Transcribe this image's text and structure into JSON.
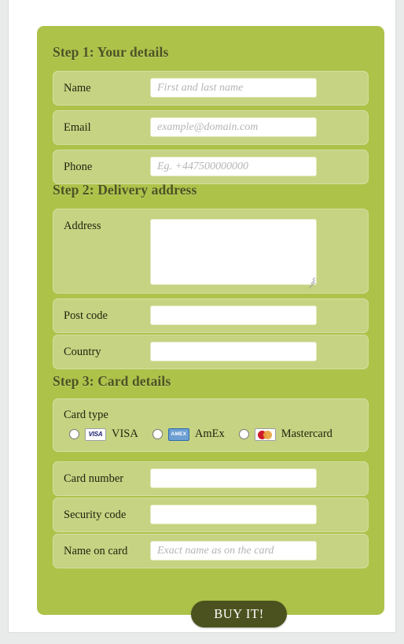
{
  "theme": {
    "page_background": "#e9eaea",
    "container_background": "#ffffff",
    "panel_green": "#adc249",
    "row_green": "#c6d382",
    "row_border": "#d4dfa1",
    "heading_color": "#4d5324",
    "label_color": "#22240f",
    "button_background": "#4b521f",
    "button_text_color": "#ffffff",
    "placeholder_color": "#b4b4b4",
    "input_background": "#ffffff"
  },
  "steps": [
    {
      "heading": "Step 1: Your details",
      "fields": [
        {
          "label": "Name",
          "value": "",
          "placeholder": "First and last name"
        },
        {
          "label": "Email",
          "value": "",
          "placeholder": "example@domain.com"
        },
        {
          "label": "Phone",
          "value": "",
          "placeholder": "Eg. +447500000000"
        }
      ]
    },
    {
      "heading": "Step 2: Delivery address",
      "fields": [
        {
          "label": "Address",
          "value": "",
          "placeholder": ""
        },
        {
          "label": "Post code",
          "value": "",
          "placeholder": ""
        },
        {
          "label": "Country",
          "value": "",
          "placeholder": ""
        }
      ]
    },
    {
      "heading": "Step 3: Card details",
      "card_type": {
        "label": "Card type",
        "options": [
          {
            "label": "VISA",
            "logo": "visa-logo",
            "logo_text": "VISA",
            "selected": false
          },
          {
            "label": "AmEx",
            "logo": "amex-logo",
            "logo_text": "AMEX",
            "selected": false
          },
          {
            "label": "Mastercard",
            "logo": "mastercard-logo",
            "logo_text": "",
            "selected": false
          }
        ]
      },
      "fields": [
        {
          "label": "Card number",
          "value": "",
          "placeholder": ""
        },
        {
          "label": "Security code",
          "value": "",
          "placeholder": ""
        },
        {
          "label": "Name on card",
          "value": "",
          "placeholder": "Exact name as on the card"
        }
      ]
    }
  ],
  "submit": {
    "label": "BUY IT!"
  }
}
